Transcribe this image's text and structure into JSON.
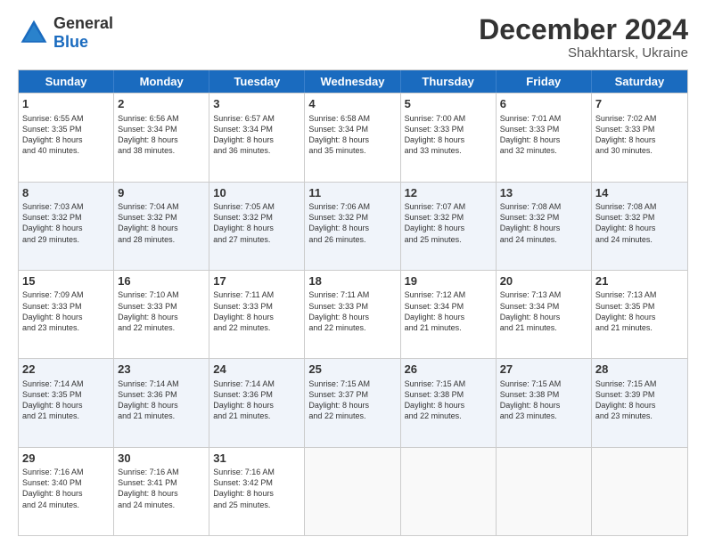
{
  "header": {
    "logo_general": "General",
    "logo_blue": "Blue",
    "month_title": "December 2024",
    "subtitle": "Shakhtarsk, Ukraine"
  },
  "calendar": {
    "days_of_week": [
      "Sunday",
      "Monday",
      "Tuesday",
      "Wednesday",
      "Thursday",
      "Friday",
      "Saturday"
    ],
    "rows": [
      [
        {
          "day": "1",
          "lines": [
            "Sunrise: 6:55 AM",
            "Sunset: 3:35 PM",
            "Daylight: 8 hours",
            "and 40 minutes."
          ]
        },
        {
          "day": "2",
          "lines": [
            "Sunrise: 6:56 AM",
            "Sunset: 3:34 PM",
            "Daylight: 8 hours",
            "and 38 minutes."
          ]
        },
        {
          "day": "3",
          "lines": [
            "Sunrise: 6:57 AM",
            "Sunset: 3:34 PM",
            "Daylight: 8 hours",
            "and 36 minutes."
          ]
        },
        {
          "day": "4",
          "lines": [
            "Sunrise: 6:58 AM",
            "Sunset: 3:34 PM",
            "Daylight: 8 hours",
            "and 35 minutes."
          ]
        },
        {
          "day": "5",
          "lines": [
            "Sunrise: 7:00 AM",
            "Sunset: 3:33 PM",
            "Daylight: 8 hours",
            "and 33 minutes."
          ]
        },
        {
          "day": "6",
          "lines": [
            "Sunrise: 7:01 AM",
            "Sunset: 3:33 PM",
            "Daylight: 8 hours",
            "and 32 minutes."
          ]
        },
        {
          "day": "7",
          "lines": [
            "Sunrise: 7:02 AM",
            "Sunset: 3:33 PM",
            "Daylight: 8 hours",
            "and 30 minutes."
          ]
        }
      ],
      [
        {
          "day": "8",
          "lines": [
            "Sunrise: 7:03 AM",
            "Sunset: 3:32 PM",
            "Daylight: 8 hours",
            "and 29 minutes."
          ]
        },
        {
          "day": "9",
          "lines": [
            "Sunrise: 7:04 AM",
            "Sunset: 3:32 PM",
            "Daylight: 8 hours",
            "and 28 minutes."
          ]
        },
        {
          "day": "10",
          "lines": [
            "Sunrise: 7:05 AM",
            "Sunset: 3:32 PM",
            "Daylight: 8 hours",
            "and 27 minutes."
          ]
        },
        {
          "day": "11",
          "lines": [
            "Sunrise: 7:06 AM",
            "Sunset: 3:32 PM",
            "Daylight: 8 hours",
            "and 26 minutes."
          ]
        },
        {
          "day": "12",
          "lines": [
            "Sunrise: 7:07 AM",
            "Sunset: 3:32 PM",
            "Daylight: 8 hours",
            "and 25 minutes."
          ]
        },
        {
          "day": "13",
          "lines": [
            "Sunrise: 7:08 AM",
            "Sunset: 3:32 PM",
            "Daylight: 8 hours",
            "and 24 minutes."
          ]
        },
        {
          "day": "14",
          "lines": [
            "Sunrise: 7:08 AM",
            "Sunset: 3:32 PM",
            "Daylight: 8 hours",
            "and 24 minutes."
          ]
        }
      ],
      [
        {
          "day": "15",
          "lines": [
            "Sunrise: 7:09 AM",
            "Sunset: 3:33 PM",
            "Daylight: 8 hours",
            "and 23 minutes."
          ]
        },
        {
          "day": "16",
          "lines": [
            "Sunrise: 7:10 AM",
            "Sunset: 3:33 PM",
            "Daylight: 8 hours",
            "and 22 minutes."
          ]
        },
        {
          "day": "17",
          "lines": [
            "Sunrise: 7:11 AM",
            "Sunset: 3:33 PM",
            "Daylight: 8 hours",
            "and 22 minutes."
          ]
        },
        {
          "day": "18",
          "lines": [
            "Sunrise: 7:11 AM",
            "Sunset: 3:33 PM",
            "Daylight: 8 hours",
            "and 22 minutes."
          ]
        },
        {
          "day": "19",
          "lines": [
            "Sunrise: 7:12 AM",
            "Sunset: 3:34 PM",
            "Daylight: 8 hours",
            "and 21 minutes."
          ]
        },
        {
          "day": "20",
          "lines": [
            "Sunrise: 7:13 AM",
            "Sunset: 3:34 PM",
            "Daylight: 8 hours",
            "and 21 minutes."
          ]
        },
        {
          "day": "21",
          "lines": [
            "Sunrise: 7:13 AM",
            "Sunset: 3:35 PM",
            "Daylight: 8 hours",
            "and 21 minutes."
          ]
        }
      ],
      [
        {
          "day": "22",
          "lines": [
            "Sunrise: 7:14 AM",
            "Sunset: 3:35 PM",
            "Daylight: 8 hours",
            "and 21 minutes."
          ]
        },
        {
          "day": "23",
          "lines": [
            "Sunrise: 7:14 AM",
            "Sunset: 3:36 PM",
            "Daylight: 8 hours",
            "and 21 minutes."
          ]
        },
        {
          "day": "24",
          "lines": [
            "Sunrise: 7:14 AM",
            "Sunset: 3:36 PM",
            "Daylight: 8 hours",
            "and 21 minutes."
          ]
        },
        {
          "day": "25",
          "lines": [
            "Sunrise: 7:15 AM",
            "Sunset: 3:37 PM",
            "Daylight: 8 hours",
            "and 22 minutes."
          ]
        },
        {
          "day": "26",
          "lines": [
            "Sunrise: 7:15 AM",
            "Sunset: 3:38 PM",
            "Daylight: 8 hours",
            "and 22 minutes."
          ]
        },
        {
          "day": "27",
          "lines": [
            "Sunrise: 7:15 AM",
            "Sunset: 3:38 PM",
            "Daylight: 8 hours",
            "and 23 minutes."
          ]
        },
        {
          "day": "28",
          "lines": [
            "Sunrise: 7:15 AM",
            "Sunset: 3:39 PM",
            "Daylight: 8 hours",
            "and 23 minutes."
          ]
        }
      ],
      [
        {
          "day": "29",
          "lines": [
            "Sunrise: 7:16 AM",
            "Sunset: 3:40 PM",
            "Daylight: 8 hours",
            "and 24 minutes."
          ]
        },
        {
          "day": "30",
          "lines": [
            "Sunrise: 7:16 AM",
            "Sunset: 3:41 PM",
            "Daylight: 8 hours",
            "and 24 minutes."
          ]
        },
        {
          "day": "31",
          "lines": [
            "Sunrise: 7:16 AM",
            "Sunset: 3:42 PM",
            "Daylight: 8 hours",
            "and 25 minutes."
          ]
        },
        {
          "day": "",
          "lines": []
        },
        {
          "day": "",
          "lines": []
        },
        {
          "day": "",
          "lines": []
        },
        {
          "day": "",
          "lines": []
        }
      ]
    ]
  }
}
